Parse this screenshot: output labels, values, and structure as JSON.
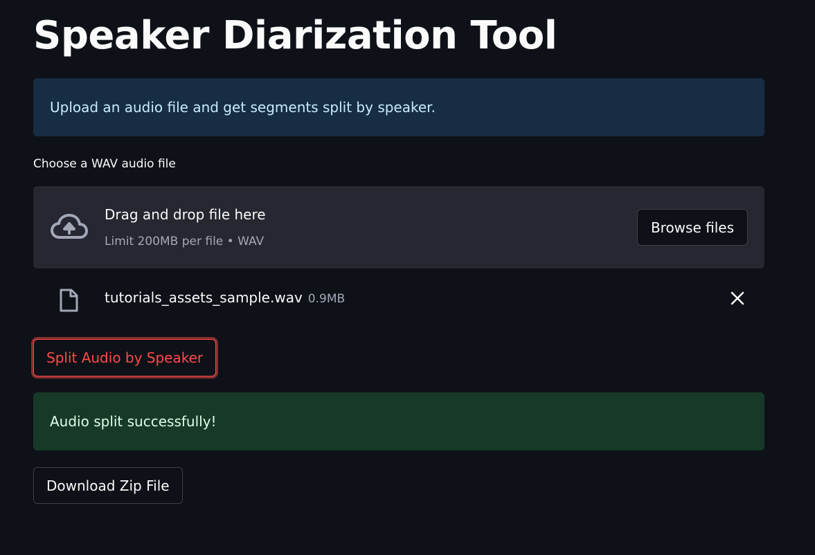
{
  "page": {
    "title": "Speaker Diarization Tool"
  },
  "info": {
    "text": "Upload an audio file and get segments split by speaker."
  },
  "uploader": {
    "label": "Choose a WAV audio file",
    "drop_text": "Drag and drop file here",
    "limit_text": "Limit 200MB per file • WAV",
    "browse_label": "Browse files",
    "icon": "cloud-upload-icon"
  },
  "uploaded_file": {
    "name": "tutorials_assets_sample.wav",
    "size": "0.9MB",
    "icon": "file-icon",
    "remove_icon": "close-icon"
  },
  "actions": {
    "split_label": "Split Audio by Speaker",
    "download_label": "Download Zip File"
  },
  "status": {
    "success_text": "Audio split successfully!"
  },
  "colors": {
    "background": "#0e1117",
    "info_bg": "#172d43",
    "info_text": "#c7ebff",
    "success_bg": "#173928",
    "success_text": "#dffde9",
    "primary_accent": "#ff4b4b",
    "dropzone_bg": "#262730"
  }
}
